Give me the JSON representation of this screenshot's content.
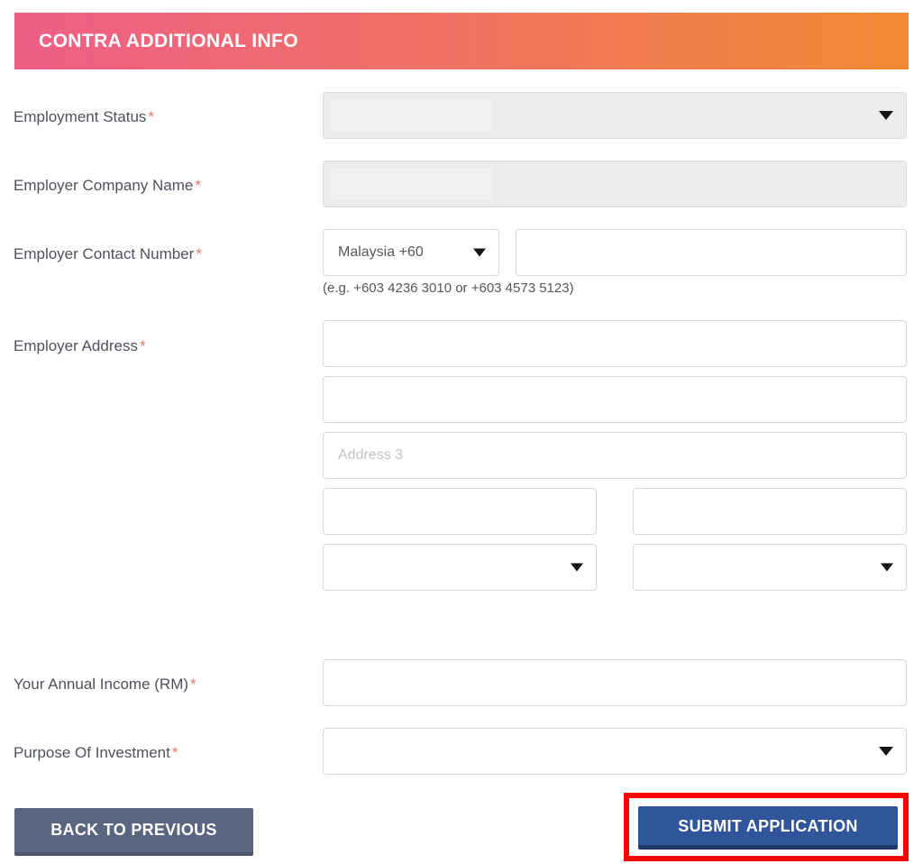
{
  "panel": {
    "title": "CONTRA ADDITIONAL INFO",
    "gradient_start": "#ee5f87",
    "gradient_end": "#f28a33"
  },
  "colors": {
    "required_asterisk": "#e8776f",
    "label_text": "#4e525c",
    "disabled_field": "#ececec",
    "submit_button": "#30559b",
    "back_button": "#5a6680",
    "highlight_box": "#fe0000"
  },
  "form": {
    "required_marker": "*",
    "fields": {
      "employment_status": {
        "label": "Employment Status",
        "required": true,
        "type": "select",
        "value": "",
        "disabled": true
      },
      "employer_company_name": {
        "label": "Employer Company Name",
        "required": true,
        "type": "text",
        "value": "",
        "disabled": true
      },
      "employer_contact_number": {
        "label": "Employer Contact Number",
        "required": true,
        "type": "phone",
        "country_code_value": "Malaysia +60",
        "number_value": "",
        "hint": "(e.g. +603 4236 3010 or +603 4573 5123)"
      },
      "employer_address": {
        "label": "Employer Address",
        "required": true,
        "line1_value": "",
        "line1_placeholder": "",
        "line2_value": "",
        "line2_placeholder": "",
        "line3_value": "",
        "line3_placeholder": "Address 3",
        "postcode_value": "",
        "city_value": "",
        "state_value": "",
        "country_value": ""
      },
      "annual_income": {
        "label": "Your Annual Income (RM)",
        "required": true,
        "type": "text",
        "value": ""
      },
      "purpose_of_investment": {
        "label": "Purpose Of Investment",
        "required": true,
        "type": "select",
        "value": ""
      }
    }
  },
  "actions": {
    "back_label": "BACK TO PREVIOUS",
    "submit_label": "SUBMIT APPLICATION"
  }
}
